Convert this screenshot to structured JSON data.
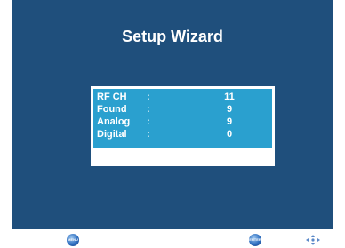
{
  "screen": {
    "title": "Setup Wizard"
  },
  "scan_info": {
    "rows": [
      {
        "label": "RF CH",
        "colon": ":",
        "value": "11"
      },
      {
        "label": "Found",
        "colon": ":",
        "value": "9"
      },
      {
        "label": "Analog",
        "colon": ":",
        "value": "9"
      },
      {
        "label": "Digital",
        "colon": ":",
        "value": "0"
      }
    ],
    "progress": 0
  },
  "footer": {
    "left_button_text": "MENU",
    "right_button_text": "ENTER",
    "nav_icon": "navigation-arrows-icon"
  },
  "colors": {
    "screen_bg": "#1f4f7c",
    "panel_bg": "#2aa0cf",
    "text": "#ffffff"
  }
}
